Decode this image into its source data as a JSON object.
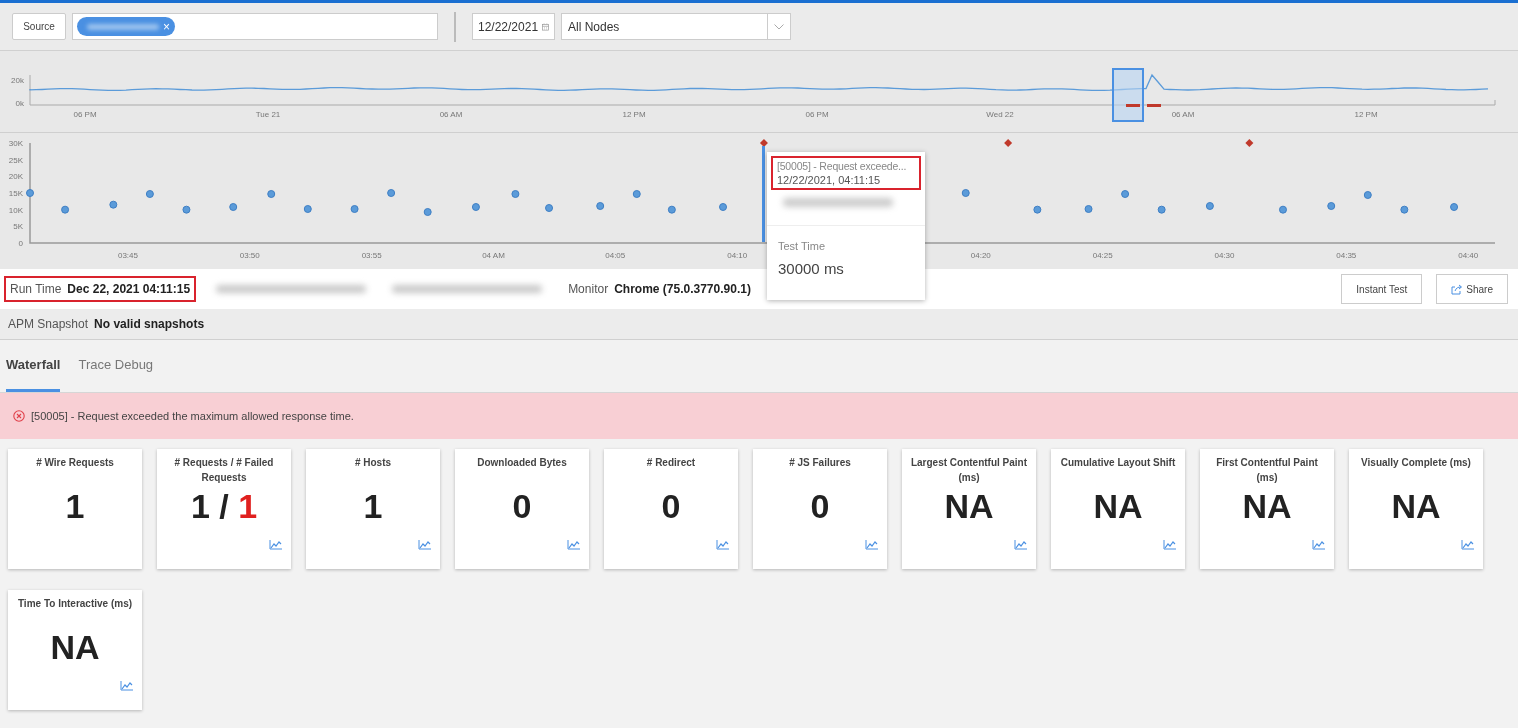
{
  "toolbar": {
    "source_button": "Source",
    "tag_remove": "×",
    "date": "12/22/2021",
    "node_select": "All Nodes"
  },
  "overview": {
    "y_labels": [
      "20k",
      "0k"
    ],
    "x_labels": [
      "06 PM",
      "Tue 21",
      "06 AM",
      "12 PM",
      "06 PM",
      "Wed 22",
      "06 AM",
      "12 PM"
    ]
  },
  "timeline": {
    "chart_data": {
      "type": "scatter",
      "x": [
        3.683,
        3.707,
        3.74,
        3.765,
        3.79,
        3.822,
        3.848,
        3.873,
        3.905,
        3.93,
        3.955,
        3.988,
        4.015,
        4.038,
        4.073,
        4.098,
        4.122,
        4.157,
        4.185,
        4.323,
        4.352,
        4.372,
        4.407,
        4.432,
        4.457,
        4.49,
        4.517,
        4.54,
        4.573,
        4.598,
        4.623,
        4.657
      ],
      "series": [
        {
          "color": "#5b9bd9",
          "values": [
            15000,
            10000,
            11500,
            14700,
            10000,
            10800,
            14700,
            10200,
            10200,
            15000,
            9300,
            10800,
            14700,
            10500,
            11100,
            14700,
            10000,
            10800,
            null,
            15000,
            null,
            10000,
            10200,
            14700,
            10000,
            11100,
            null,
            10000,
            11100,
            14400,
            10000,
            10800
          ]
        },
        {
          "color": "#c0392b",
          "values": [
            null,
            null,
            null,
            null,
            null,
            null,
            null,
            null,
            null,
            null,
            null,
            null,
            null,
            null,
            null,
            null,
            null,
            null,
            30000,
            null,
            30000,
            null,
            null,
            null,
            null,
            null,
            30000,
            null,
            null,
            null,
            null,
            null
          ]
        }
      ],
      "xlim": [
        3.683,
        4.685
      ],
      "ylim": [
        0,
        30000
      ],
      "xticks": [
        {
          "value": 3.75,
          "label": "03:45"
        },
        {
          "value": 3.8333,
          "label": "03:50"
        },
        {
          "value": 3.9167,
          "label": "03:55"
        },
        {
          "value": 4,
          "label": "04 AM"
        },
        {
          "value": 4.0833,
          "label": "04:05"
        },
        {
          "value": 4.1667,
          "label": "04:10"
        },
        {
          "value": 4.3333,
          "label": "04:20"
        },
        {
          "value": 4.4167,
          "label": "04:25"
        },
        {
          "value": 4.5,
          "label": "04:30"
        },
        {
          "value": 4.5833,
          "label": "04:35"
        },
        {
          "value": 4.6667,
          "label": "04:40"
        }
      ],
      "yticks": [
        {
          "value": 0,
          "label": "0"
        },
        {
          "value": 5000,
          "label": "5K"
        },
        {
          "value": 10000,
          "label": "10K"
        },
        {
          "value": 15000,
          "label": "15K"
        },
        {
          "value": 20000,
          "label": "20K"
        },
        {
          "value": 25000,
          "label": "25K"
        },
        {
          "value": 30000,
          "label": "30K"
        }
      ]
    }
  },
  "tooltip": {
    "title": "[50005] - Request exceede...",
    "time": "12/22/2021, 04:11:15",
    "highlighted": true,
    "metric_label": "Test Time",
    "metric_value": "30000 ms"
  },
  "run_info": {
    "fields": [
      {
        "kind": "text",
        "label": "Run Time",
        "value": "Dec 22, 2021 04:11:15",
        "highlighted": true
      },
      {
        "kind": "blurred",
        "highlighted": false
      },
      {
        "kind": "blurred",
        "highlighted": false
      },
      {
        "kind": "text",
        "label": "Monitor",
        "value": "Chrome (75.0.3770.90.1)",
        "highlighted": false
      }
    ],
    "apm_label": "APM Snapshot",
    "apm_value": "No valid snapshots"
  },
  "actions": [
    {
      "kind": "text",
      "label": "Instant Test"
    },
    {
      "kind": "share",
      "label": "Share"
    }
  ],
  "tabs": [
    {
      "label": "Waterfall",
      "selected": true
    },
    {
      "label": "Trace Debug",
      "selected": false
    }
  ],
  "alert": "[50005] - Request exceeded the maximum allowed response time.",
  "cards": [
    {
      "title": "# Wire Requests",
      "value": "1",
      "trend": false
    },
    {
      "title": "# Requests / # Failed Requests",
      "value": "1 /",
      "failed": "1",
      "trend": true
    },
    {
      "title": "# Hosts",
      "value": "1",
      "trend": true
    },
    {
      "title": "Downloaded Bytes",
      "value": "0",
      "trend": true
    },
    {
      "title": "# Redirect",
      "value": "0",
      "trend": true
    },
    {
      "title": "# JS Failures",
      "value": "0",
      "trend": true
    },
    {
      "title": "Largest Contentful Paint (ms)",
      "value": "NA",
      "trend": true
    },
    {
      "title": "Cumulative Layout Shift",
      "value": "NA",
      "trend": true
    },
    {
      "title": "First Contentful Paint (ms)",
      "value": "NA",
      "trend": true
    },
    {
      "title": "Visually Complete (ms)",
      "value": "NA",
      "trend": true
    },
    {
      "title": "Time To Interactive (ms)",
      "value": "NA",
      "trend": true
    }
  ]
}
